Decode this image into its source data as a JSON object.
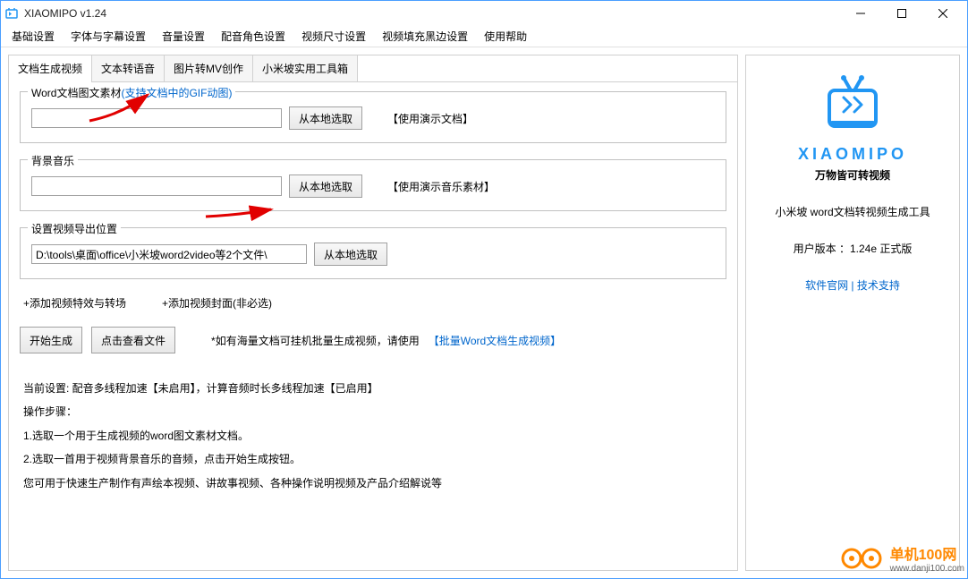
{
  "app": {
    "title": "XIAOMIPO v1.24"
  },
  "menus": [
    "基础设置",
    "字体与字幕设置",
    "音量设置",
    "配音角色设置",
    "视频尺寸设置",
    "视频填充黑边设置",
    "使用帮助"
  ],
  "tabs": [
    "文档生成视频",
    "文本转语音",
    "图片转MV创作",
    "小米坡实用工具箱"
  ],
  "group1": {
    "legend": "Word文档图文素材",
    "legend_hint": "(支持文档中的GIF动图)",
    "value": "",
    "btn": "从本地选取",
    "hint": "【使用演示文档】"
  },
  "group2": {
    "legend": "背景音乐",
    "value": "",
    "btn": "从本地选取",
    "hint": "【使用演示音乐素材】"
  },
  "group3": {
    "legend": "设置视频导出位置",
    "value": "D:\\tools\\桌面\\office\\小米坡word2video等2个文件\\",
    "btn": "从本地选取"
  },
  "plus1": "+添加视频特效与转场",
  "plus2": "+添加视频封面(非必选)",
  "action": {
    "start": "开始生成",
    "view": "点击查看文件",
    "hint": "*如有海量文档可挂机批量生成视频，请使用",
    "link": "【批量Word文档生成视频】"
  },
  "info": {
    "line0": "当前设置: 配音多线程加速【未启用】，计算音频时长多线程加速【已启用】",
    "lineA": "操作步骤：",
    "line1": "1.选取一个用于生成视频的word图文素材文档。",
    "line2": "2.选取一首用于视频背景音乐的音频，点击开始生成按钮。",
    "line3": "您可用于快速生产制作有声绘本视频、讲故事视频、各种操作说明视频及产品介绍解说等"
  },
  "brand": {
    "name": "XIAOMIPO",
    "slogan": "万物皆可转视频"
  },
  "right": {
    "desc": "小米坡 word文档转视频生成工具",
    "version": "用户版本 ：1.24e 正式版",
    "link1": "软件官网",
    "sep": " | ",
    "link2": "技术支持"
  },
  "watermark": {
    "t1": "单机100网",
    "t2": "www.danji100.com"
  }
}
